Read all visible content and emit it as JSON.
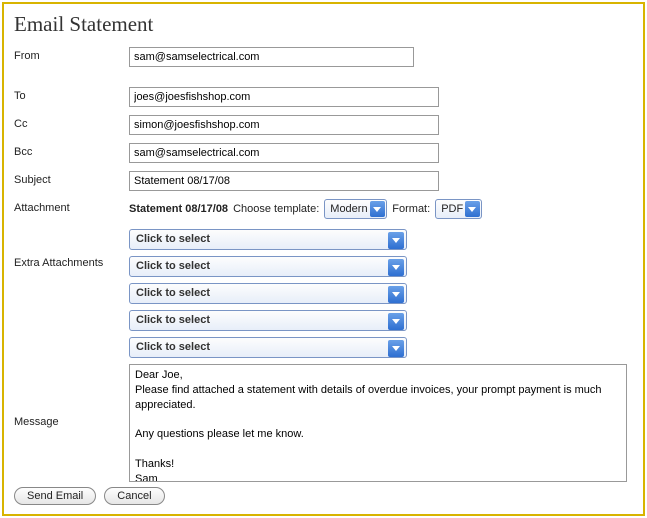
{
  "title": "Email Statement",
  "labels": {
    "from": "From",
    "to": "To",
    "cc": "Cc",
    "bcc": "Bcc",
    "subject": "Subject",
    "attachment": "Attachment",
    "extra": "Extra Attachments",
    "message": "Message",
    "choose_template": "Choose template:",
    "format": "Format:"
  },
  "fields": {
    "from": "sam@samselectrical.com",
    "to": "joes@joesfishshop.com",
    "cc": "simon@joesfishshop.com",
    "bcc": "sam@samselectrical.com",
    "subject": "Statement 08/17/08"
  },
  "attachment": {
    "name": "Statement 08/17/08",
    "template_selected": "Modern",
    "format_selected": "PDF"
  },
  "extra_placeholder": "Click to select",
  "message": "Dear Joe,\nPlease find attached a statement with details of overdue invoices, your prompt payment is much appreciated.\n\nAny questions please let me know.\n\nThanks!\nSam\n\nSam's Electrical",
  "buttons": {
    "send": "Send Email",
    "cancel": "Cancel"
  }
}
